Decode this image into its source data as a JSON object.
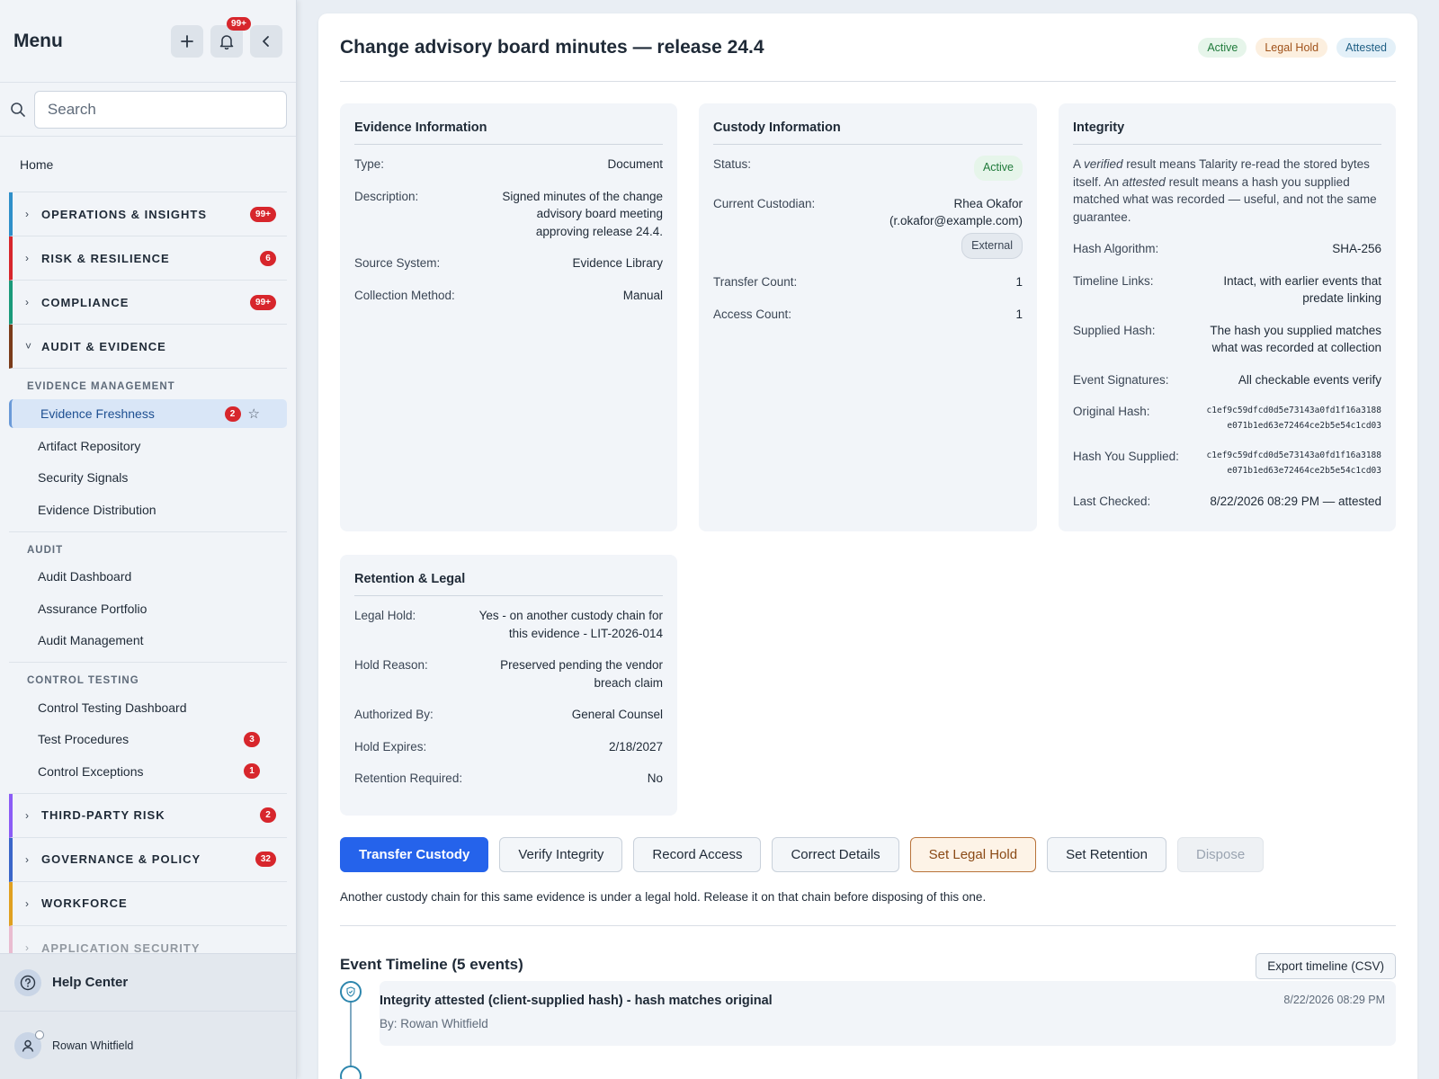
{
  "sidebar": {
    "title": "Menu",
    "notif_count": "99+",
    "search_placeholder": "Search",
    "home": "Home",
    "sections": [
      {
        "label": "OPERATIONS & INSIGHTS",
        "badge": "99+",
        "color": "#2f8fc9"
      },
      {
        "label": "RISK & RESILIENCE",
        "badge": "6",
        "color": "#d7262c"
      },
      {
        "label": "COMPLIANCE",
        "badge": "99+",
        "color": "#1a9a7a"
      },
      {
        "label": "AUDIT & EVIDENCE",
        "badge": "",
        "color": "#7a3b1a"
      },
      {
        "label": "THIRD-PARTY RISK",
        "badge": "2",
        "color": "#8b5cf6"
      },
      {
        "label": "GOVERNANCE & POLICY",
        "badge": "32",
        "color": "#3a66c9"
      },
      {
        "label": "WORKFORCE",
        "badge": "",
        "color": "#e0a020"
      },
      {
        "label": "APPLICATION SECURITY",
        "badge": "",
        "color": "#e07aa0"
      }
    ],
    "groups": [
      {
        "heading": "EVIDENCE MANAGEMENT",
        "items": [
          {
            "label": "Evidence Freshness",
            "badge": "2"
          },
          {
            "label": "Artifact Repository",
            "badge": ""
          },
          {
            "label": "Security Signals",
            "badge": ""
          },
          {
            "label": "Evidence Distribution",
            "badge": ""
          }
        ]
      },
      {
        "heading": "AUDIT",
        "items": [
          {
            "label": "Audit Dashboard",
            "badge": ""
          },
          {
            "label": "Assurance Portfolio",
            "badge": ""
          },
          {
            "label": "Audit Management",
            "badge": ""
          }
        ]
      },
      {
        "heading": "CONTROL TESTING",
        "items": [
          {
            "label": "Control Testing Dashboard",
            "badge": ""
          },
          {
            "label": "Test Procedures",
            "badge": "3"
          },
          {
            "label": "Control Exceptions",
            "badge": "1"
          }
        ]
      }
    ],
    "help": "Help Center",
    "user": "Rowan Whitfield"
  },
  "main": {
    "title": "Change advisory board minutes — release 24.4",
    "statuses": [
      "Active",
      "Legal Hold",
      "Attested"
    ],
    "evidence": {
      "heading": "Evidence Information",
      "type_k": "Type:",
      "type_v": "Document",
      "desc_k": "Description:",
      "desc_v": "Signed minutes of the change advisory board meeting approving release 24.4.",
      "source_k": "Source System:",
      "source_v": "Evidence Library",
      "method_k": "Collection Method:",
      "method_v": "Manual"
    },
    "custody": {
      "heading": "Custody Information",
      "status_k": "Status:",
      "status_v": "Active",
      "custodian_k": "Current Custodian:",
      "custodian_name": "Rhea Okafor",
      "custodian_email": "(r.okafor@example.com)",
      "custodian_tag": "External",
      "transfer_k": "Transfer Count:",
      "transfer_v": "1",
      "access_k": "Access Count:",
      "access_v": "1"
    },
    "integrity": {
      "heading": "Integrity",
      "intro_a": "A ",
      "intro_verified": "verified",
      "intro_b": " result means Talarity re-read the stored bytes itself. An ",
      "intro_attested": "attested",
      "intro_c": " result means a hash you supplied matched what was recorded — useful, and not the same guarantee.",
      "algo_k": "Hash Algorithm:",
      "algo_v": "SHA-256",
      "links_k": "Timeline Links:",
      "links_v": "Intact, with earlier events that predate linking",
      "supplied_k": "Supplied Hash:",
      "supplied_v": "The hash you supplied matches what was recorded at collection",
      "sigs_k": "Event Signatures:",
      "sigs_v": "All checkable events verify",
      "orig_k": "Original Hash:",
      "orig_v1": "c1ef9c59dfcd0d5e73143a0fd1f16a3188",
      "orig_v2": "e071b1ed63e72464ce2b5e54c1cd03",
      "yours_k": "Hash You Supplied:",
      "yours_v1": "c1ef9c59dfcd0d5e73143a0fd1f16a3188",
      "yours_v2": "e071b1ed63e72464ce2b5e54c1cd03",
      "checked_k": "Last Checked:",
      "checked_v": "8/22/2026 08:29 PM — attested"
    },
    "retention": {
      "heading": "Retention & Legal",
      "hold_k": "Legal Hold:",
      "hold_v": "Yes - on another custody chain for this evidence - LIT-2026-014",
      "reason_k": "Hold Reason:",
      "reason_v": "Preserved pending the vendor breach claim",
      "auth_k": "Authorized By:",
      "auth_v": "General Counsel",
      "expires_k": "Hold Expires:",
      "expires_v": "2/18/2027",
      "required_k": "Retention Required:",
      "required_v": "No"
    },
    "actions": {
      "transfer": "Transfer Custody",
      "verify": "Verify Integrity",
      "record": "Record Access",
      "correct": "Correct Details",
      "hold": "Set Legal Hold",
      "retention": "Set Retention",
      "dispose": "Dispose"
    },
    "notice": "Another custody chain for this same evidence is under a legal hold. Release it on that chain before disposing of this one.",
    "timeline": {
      "title": "Event Timeline (5 events)",
      "export": "Export timeline (CSV)",
      "events": [
        {
          "title": "Integrity attested (client-supplied hash) - hash matches original",
          "by": "By: Rowan Whitfield",
          "time": "8/22/2026 08:29 PM"
        }
      ]
    }
  }
}
